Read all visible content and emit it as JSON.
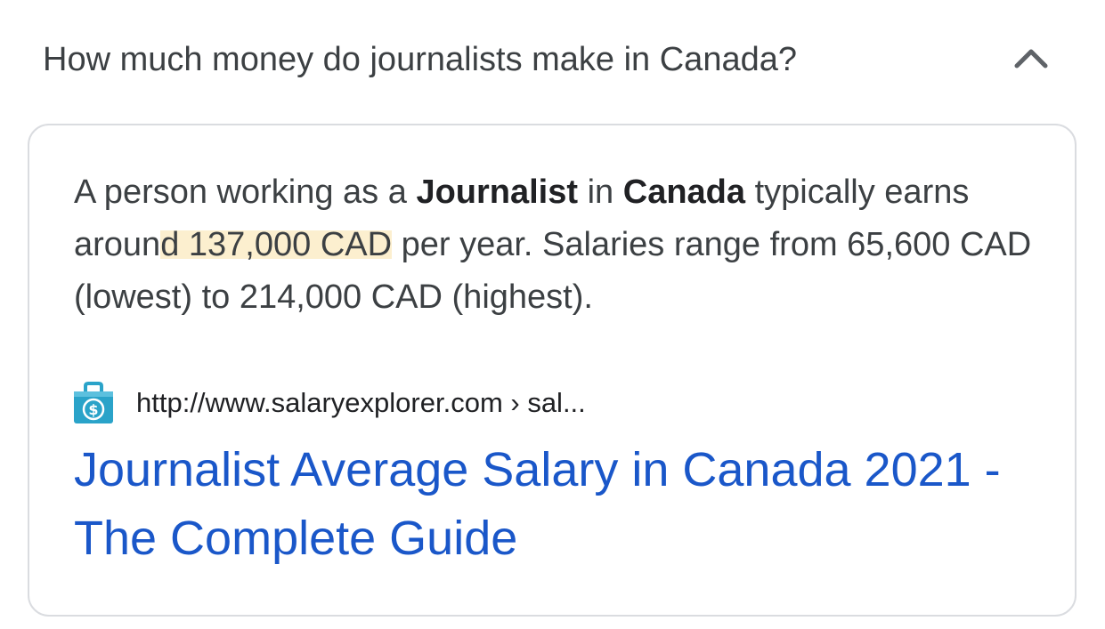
{
  "question": {
    "text": "How much money do journalists make in Canada?",
    "expanded_icon": "chevron-up-icon"
  },
  "answer": {
    "snippet": {
      "part1": "A person working as a ",
      "bold1": "Journalist",
      "part2": " in ",
      "bold2": "Canada",
      "part3": " typically earns aroun",
      "highlight": "d 137,000 CAD",
      "part4": " per year. Salaries range from 65,600 CAD (lowest) to 214,000 CAD (highest)."
    },
    "source": {
      "favicon_icon": "money-bag-icon",
      "url": "http://www.salaryexplorer.com › sal..."
    },
    "title": "Journalist Average Salary in Canada 2021 - The Complete Guide"
  },
  "colors": {
    "link": "#1a57c9",
    "highlight": "#fcefcf",
    "favicon": "#2aa3c9",
    "card_border": "#dadce0"
  }
}
